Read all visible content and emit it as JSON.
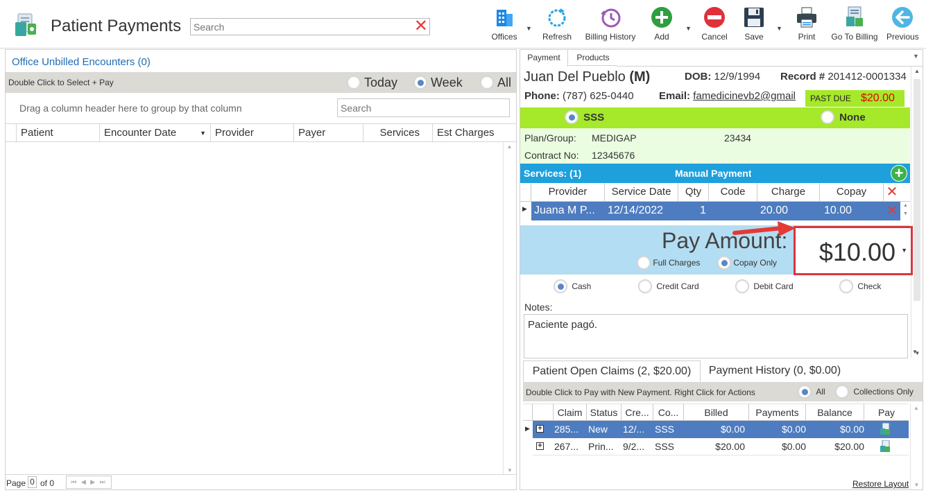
{
  "header": {
    "title": "Patient Payments",
    "search_placeholder": "Search",
    "toolbar": [
      {
        "id": "offices",
        "label": "Offices"
      },
      {
        "id": "refresh",
        "label": "Refresh"
      },
      {
        "id": "billing_history",
        "label": "Billing History"
      },
      {
        "id": "add",
        "label": "Add"
      },
      {
        "id": "cancel",
        "label": "Cancel"
      },
      {
        "id": "save",
        "label": "Save"
      },
      {
        "id": "print",
        "label": "Print"
      },
      {
        "id": "go_to_billing",
        "label": "Go To Billing"
      },
      {
        "id": "previous",
        "label": "Previous"
      }
    ]
  },
  "left": {
    "title": "Office Unbilled Encounters (0)",
    "hint": "Double Click to Select + Pay",
    "filters": [
      {
        "label": "Today",
        "selected": false
      },
      {
        "label": "Week",
        "selected": true
      },
      {
        "label": "All",
        "selected": false
      }
    ],
    "group_hint": "Drag a column header here to group by that column",
    "search_placeholder": "Search",
    "columns": [
      "Patient",
      "Encounter Date",
      "Provider",
      "Payer",
      "Services",
      "Est Charges"
    ],
    "pager": {
      "page_label": "Page",
      "page": "0",
      "of_label": "of 0"
    }
  },
  "right": {
    "tabs": [
      "Payment",
      "Products"
    ],
    "patient": {
      "name": "Juan Del Pueblo",
      "gender": "(M)",
      "dob_label": "DOB:",
      "dob": "12/9/1994",
      "record_label": "Record #",
      "record": "201412-0001334",
      "phone_label": "Phone:",
      "phone": "(787) 625-0440",
      "email_label": "Email:",
      "email": "famedicinevb2@gmail",
      "past_due_label": "PAST DUE",
      "past_due_amount": "$20.00"
    },
    "insurance": {
      "options": [
        {
          "label": "SSS",
          "selected": true
        },
        {
          "label": "None",
          "selected": false
        }
      ],
      "plan_label": "Plan/Group:",
      "plan": "MEDIGAP",
      "group": "23434",
      "contract_label": "Contract No:",
      "contract": "12345676"
    },
    "services": {
      "title": "Services: (1)",
      "mode": "Manual Payment",
      "columns": [
        "Provider",
        "Service Date",
        "Qty",
        "Code",
        "Charge",
        "Copay"
      ],
      "rows": [
        [
          "Juana M P...",
          "12/14/2022",
          "1",
          "",
          "20.00",
          "10.00"
        ]
      ]
    },
    "pay": {
      "label": "Pay Amount:",
      "amount": "$10.00",
      "options": [
        {
          "label": "Full Charges",
          "selected": false
        },
        {
          "label": "Copay Only",
          "selected": true
        }
      ],
      "methods": [
        {
          "label": "Cash",
          "selected": true
        },
        {
          "label": "Credit Card",
          "selected": false
        },
        {
          "label": "Debit Card",
          "selected": false
        },
        {
          "label": "Check",
          "selected": false
        }
      ]
    },
    "notes": {
      "label": "Notes:",
      "value": "Paciente pagó."
    },
    "claims": {
      "tabs": [
        "Patient Open Claims (2, $20.00)",
        "Payment History (0, $0.00)"
      ],
      "hint": "Double Click to Pay with New Payment. Right Click for Actions",
      "filters": [
        {
          "label": "All",
          "selected": true
        },
        {
          "label": "Collections Only",
          "selected": false
        }
      ],
      "columns": [
        "Claim",
        "Status",
        "Cre...",
        "Co...",
        "Billed",
        "Payments",
        "Balance",
        "Pay"
      ],
      "rows": [
        [
          "285...",
          "New",
          "12/...",
          "SSS",
          "$0.00",
          "$0.00",
          "$0.00"
        ],
        [
          "267...",
          "Prin...",
          "9/2...",
          "SSS",
          "$20.00",
          "$0.00",
          "$20.00"
        ]
      ],
      "restore": "Restore Layout"
    }
  },
  "colors": {
    "accent": "#1ea0dc",
    "lime": "#a6e82a",
    "selected_row": "#4d7cc0",
    "pay_bg": "#b3ddf2",
    "highlight": "#d9363e",
    "past_due": "#e00000"
  }
}
